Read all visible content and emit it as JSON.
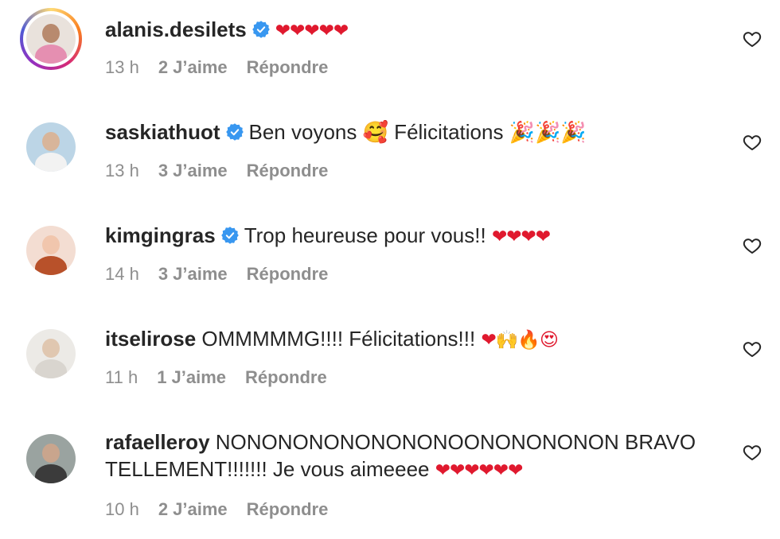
{
  "comments": [
    {
      "username": "alanis.desilets",
      "verified": true,
      "story_ring": true,
      "text": "",
      "emoji": "❤❤❤❤❤",
      "time": "13 h",
      "likes": "2 J’aime",
      "reply": "Répondre",
      "avatar_colors": {
        "bg": "#e9e2dc",
        "head": "#b88a6e",
        "body": "#e58fb1"
      }
    },
    {
      "username": "saskiathuot",
      "verified": true,
      "story_ring": false,
      "text": "Ben voyons 🥰 Félicitations 🎉🎉🎉",
      "emoji": "",
      "time": "13 h",
      "likes": "3 J’aime",
      "reply": "Répondre",
      "avatar_colors": {
        "bg": "#bcd5e6",
        "head": "#d8b59a",
        "body": "#f2f2f2"
      }
    },
    {
      "username": "kimgingras",
      "verified": true,
      "story_ring": false,
      "text": "Trop heureuse pour vous!! ",
      "emoji": "❤❤❤❤",
      "time": "14 h",
      "likes": "3 J’aime",
      "reply": "Répondre",
      "avatar_colors": {
        "bg": "#f3ddd2",
        "head": "#f1c6ad",
        "body": "#b8512a"
      }
    },
    {
      "username": "itselirose",
      "verified": false,
      "story_ring": false,
      "text": "OMMMMMG!!!! Félicitations!!! ",
      "emoji": "❤🙌🔥😍",
      "time": "11 h",
      "likes": "1 J’aime",
      "reply": "Répondre",
      "avatar_colors": {
        "bg": "#eceae6",
        "head": "#e0c7b0",
        "body": "#d9d5cf"
      }
    },
    {
      "username": "rafaelleroy",
      "verified": false,
      "story_ring": false,
      "text": "NONONONONONONONOONONONONON BRAVO TELLEMENT!!!!!!! Je vous aimeeee ",
      "emoji": "❤❤❤❤❤❤",
      "time": "10 h",
      "likes": "2 J’aime",
      "reply": "Répondre",
      "avatar_colors": {
        "bg": "#9aa3a0",
        "head": "#c9a58d",
        "body": "#3b3b3b"
      }
    }
  ],
  "colors": {
    "verified_badge": "#3897f0",
    "meta_text": "#8e8e8e",
    "heart_emoji": "#e0192e"
  },
  "icons": {
    "like_button": "heart-outline-icon",
    "verified": "verified-badge-icon"
  }
}
